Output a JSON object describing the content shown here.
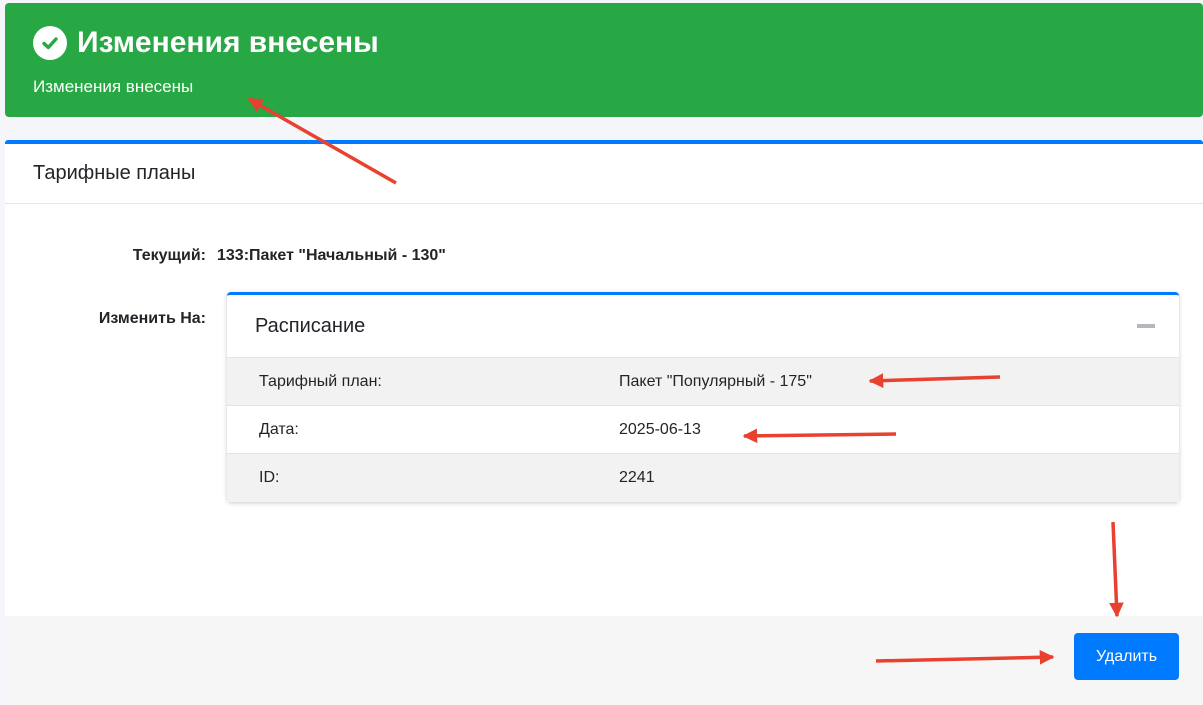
{
  "alert": {
    "title": "Изменения внесены",
    "message": "Изменения внесены",
    "color": "#28a745"
  },
  "card": {
    "title": "Тарифные планы",
    "current_label": "Текущий:",
    "current_value": "133:Пакет \"Начальный - 130\"",
    "change_label": "Изменить На:"
  },
  "schedule": {
    "title": "Расписание",
    "rows": [
      {
        "label": "Тарифный план:",
        "value": "Пакет \"Популярный - 175\""
      },
      {
        "label": "Дата:",
        "value": "2025-06-13"
      },
      {
        "label": "ID:",
        "value": "2241"
      }
    ]
  },
  "footer": {
    "delete_label": "Удалить",
    "accent_color": "#007bff"
  },
  "annotations": {
    "arrow_color": "#e8412f"
  }
}
